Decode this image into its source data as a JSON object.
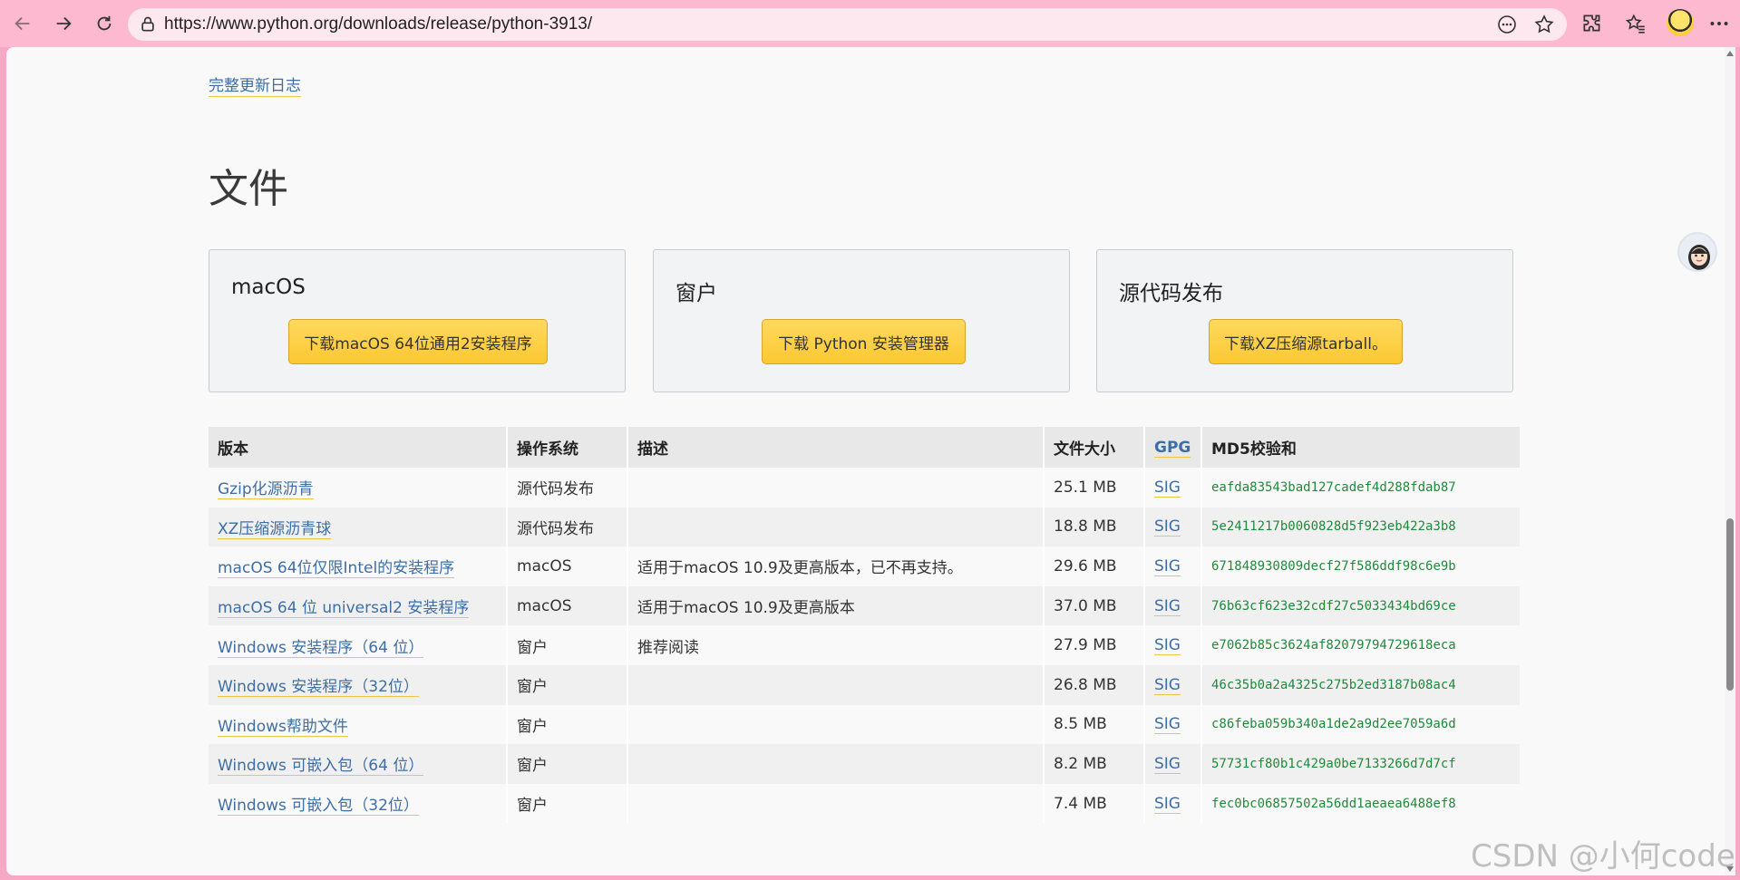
{
  "browser": {
    "url": "https://www.python.org/downloads/release/python-3913/"
  },
  "page": {
    "changelog_link": "完整更新日志",
    "section_title": "文件",
    "cards": [
      {
        "title": "macOS",
        "button": "下载macOS 64位通用2安装程序"
      },
      {
        "title": "窗户",
        "button": "下载 Python 安装管理器"
      },
      {
        "title": "源代码发布",
        "button": "下载XZ压缩源tarball。"
      }
    ],
    "table": {
      "headers": [
        "版本",
        "操作系统",
        "描述",
        "文件大小",
        "GPG",
        "MD5校验和"
      ],
      "rows": [
        {
          "version": "Gzip化源沥青",
          "os": "源代码发布",
          "desc": "",
          "size": "25.1 MB",
          "gpg": "SIG",
          "md5": "eafda83543bad127cadef4d288fdab87"
        },
        {
          "version": "XZ压缩源沥青球",
          "os": "源代码发布",
          "desc": "",
          "size": "18.8 MB",
          "gpg": "SIG",
          "md5": "5e2411217b0060828d5f923eb422a3b8"
        },
        {
          "version": "macOS 64位仅限Intel的安装程序",
          "os": "macOS",
          "desc": "适用于macOS 10.9及更高版本，已不再支持。",
          "size": "29.6 MB",
          "gpg": "SIG",
          "md5": "671848930809decf27f586ddf98c6e9b"
        },
        {
          "version": "macOS 64 位 universal2 安装程序",
          "os": "macOS",
          "desc": "适用于macOS 10.9及更高版本",
          "size": "37.0 MB",
          "gpg": "SIG",
          "md5": "76b63cf623e32cdf27c5033434bd69ce"
        },
        {
          "version": "Windows 安装程序（64 位）",
          "os": "窗户",
          "desc": "推荐阅读",
          "size": "27.9 MB",
          "gpg": "SIG",
          "md5": "e7062b85c3624af82079794729618eca"
        },
        {
          "version": "Windows 安装程序（32位）",
          "os": "窗户",
          "desc": "",
          "size": "26.8 MB",
          "gpg": "SIG",
          "md5": "46c35b0a2a4325c275b2ed3187b08ac4"
        },
        {
          "version": "Windows帮助文件",
          "os": "窗户",
          "desc": "",
          "size": "8.5 MB",
          "gpg": "SIG",
          "md5": "c86feba059b340a1de2a9d2ee7059a6d"
        },
        {
          "version": "Windows 可嵌入包（64 位）",
          "os": "窗户",
          "desc": "",
          "size": "8.2 MB",
          "gpg": "SIG",
          "md5": "57731cf80b1c429a0be7133266d7d7cf"
        },
        {
          "version": "Windows 可嵌入包（32位）",
          "os": "窗户",
          "desc": "",
          "size": "7.4 MB",
          "gpg": "SIG",
          "md5": "fec0bc06857502a56dd1aeaea6488ef8"
        }
      ]
    }
  },
  "watermark": "CSDN @小何code",
  "icons": {
    "back": "back-arrow-icon",
    "forward": "forward-arrow-icon",
    "reload": "reload-icon",
    "site_info": "lock-icon",
    "more_page": "ellipsis-circle-icon",
    "favorite": "star-icon",
    "extensions": "puzzle-icon",
    "favorites_list": "favorites-icon",
    "menu": "more-icon"
  },
  "colors": {
    "toolbar": "#fcb9d0",
    "link": "#3d6ea6",
    "button": "#fcc833",
    "md5": "#1f8a3a"
  }
}
